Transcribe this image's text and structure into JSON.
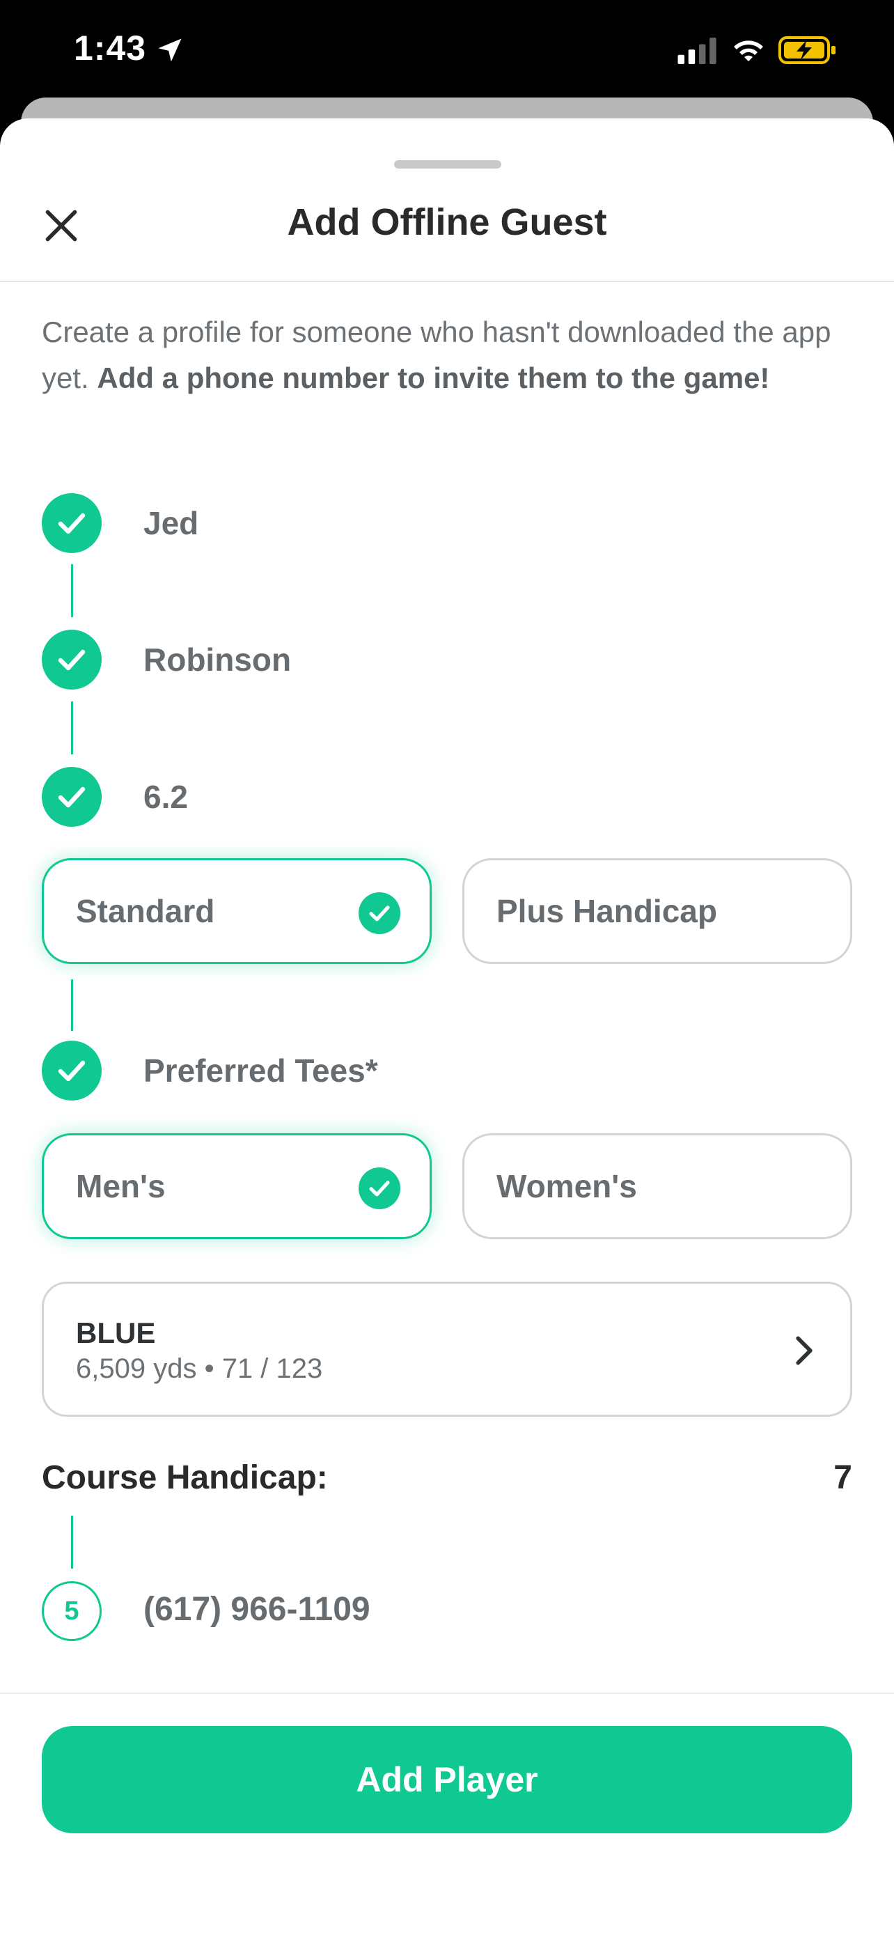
{
  "status_bar": {
    "time": "1:43",
    "icons": [
      "location-arrow-icon",
      "signal-icon",
      "wifi-icon",
      "battery-charging-icon"
    ]
  },
  "sheet": {
    "title": "Add Offline Guest",
    "close_icon": "close-icon",
    "intro_text": "Create a profile for someone who hasn't downloaded the app yet. ",
    "intro_bold": "Add a phone number to invite them to the game!"
  },
  "steps": {
    "first_name": "Jed",
    "last_name": "Robinson",
    "handicap_index": "6.2",
    "handicap_type_options": [
      {
        "label": "Standard",
        "selected": true
      },
      {
        "label": "Plus Handicap",
        "selected": false
      }
    ],
    "preferred_tees_label": "Preferred Tees*",
    "tee_gender_options": [
      {
        "label": "Men's",
        "selected": true
      },
      {
        "label": "Women's",
        "selected": false
      }
    ],
    "tee": {
      "name": "BLUE",
      "info": "6,509 yds • 71 / 123"
    },
    "course_handicap_label": "Course Handicap:",
    "course_handicap_value": "7",
    "phone_step_number": "5",
    "phone": "(617) 966-1109"
  },
  "footer": {
    "add_button": "Add Player"
  },
  "colors": {
    "accent": "#10c891",
    "text_dark": "#2a2a2a",
    "text_muted": "#676c70"
  }
}
